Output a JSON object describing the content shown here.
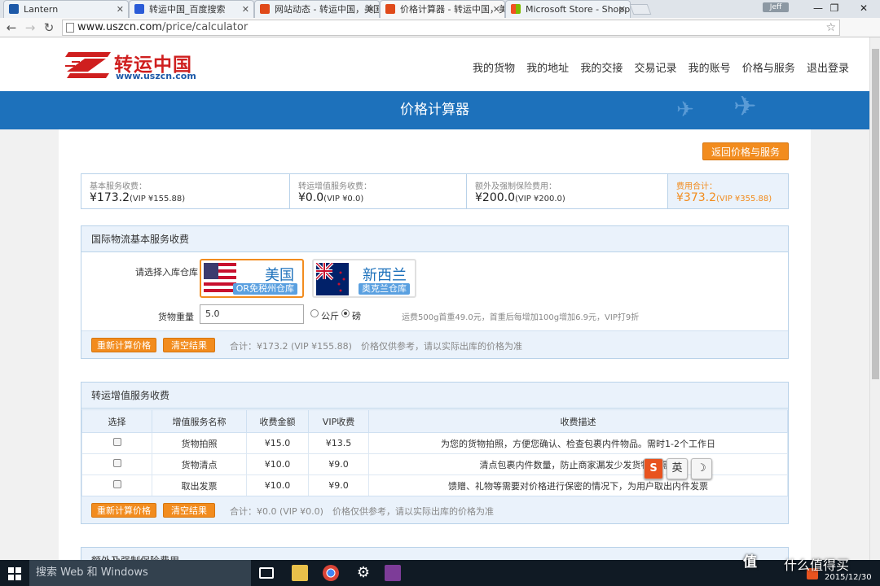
{
  "browser": {
    "tabs": [
      {
        "title": "Lantern",
        "icon_color": "#1d59a8"
      },
      {
        "title": "转运中国_百度搜索",
        "icon_color": "#2a5bd7"
      },
      {
        "title": "网站动态 - 转运中国，美国",
        "icon_color": "#e04a1a"
      },
      {
        "title": "价格计算器 - 转运中国，美",
        "icon_color": "#e04a1a"
      },
      {
        "title": "Microsoft Store - Shopp",
        "icon_color": "#f25022"
      }
    ],
    "active_tab": 3,
    "user": "Jeff",
    "url_host": "www.uszcn.com",
    "url_path": "/price/calculator"
  },
  "site": {
    "logo_text": "转运中国",
    "logo_url": "www.uszcn.com",
    "nav": [
      "我的货物",
      "我的地址",
      "我的交接",
      "交易记录",
      "我的账号",
      "价格与服务",
      "退出登录"
    ],
    "banner_title": "价格计算器",
    "return_button": "返回价格与服务"
  },
  "summary": [
    {
      "label": "基本服务收费：",
      "value": "¥173.2",
      "vip": "(VIP ¥155.88)"
    },
    {
      "label": "转运增值服务收费：",
      "value": "¥0.0",
      "vip": "(VIP ¥0.0)"
    },
    {
      "label": "额外及强制保险费用：",
      "value": "¥200.0",
      "vip": "(VIP ¥200.0)"
    },
    {
      "label": "费用合计：",
      "value": "¥373.2",
      "vip": "(VIP ¥355.88)"
    }
  ],
  "basic": {
    "title": "国际物流基本服务收费",
    "warehouse_label": "请选择入库仓库",
    "warehouses": [
      {
        "name": "美国",
        "sub": "OR免税州仓库"
      },
      {
        "name": "新西兰",
        "sub": "奥克兰仓库"
      }
    ],
    "weight_label": "货物重量",
    "weight_value": "5.0",
    "unit_kg": "公斤",
    "unit_lb": "磅",
    "rate_note": "运费500g首重49.0元，首重后每增加100g增加6.9元，VIP打9折",
    "recalc_button": "重新计算价格",
    "clear_button": "清空结果",
    "total_note": "合计：¥173.2 (VIP ¥155.88)　价格仅供参考，请以实际出库的价格为准"
  },
  "addon": {
    "title": "转运增值服务收费",
    "headers": [
      "选择",
      "增值服务名称",
      "收费金额",
      "VIP收费",
      "收费描述"
    ],
    "rows": [
      [
        "货物拍照",
        "¥15.0",
        "¥13.5",
        "为您的货物拍照，方便您确认、检查包裹内件物品。需时1-2个工作日"
      ],
      [
        "货物清点",
        "¥10.0",
        "¥9.0",
        "清点包裹内件数量，防止商家漏发少发货物。需时"
      ],
      [
        "取出发票",
        "¥10.0",
        "¥9.0",
        "馈赠、礼物等需要对价格进行保密的情况下，为用户取出内件发票"
      ]
    ],
    "recalc_button": "重新计算价格",
    "clear_button": "清空结果",
    "total_note": "合计：¥0.0 (VIP ¥0.0)　价格仅供参考，请以实际出库的价格为准"
  },
  "next_section_title": "额外及强制保险费用",
  "ime": {
    "s": "S",
    "lang": "英",
    "moon": "☽"
  },
  "taskbar": {
    "search_placeholder": "搜索 Web 和 Windows",
    "time": "",
    "date": "2015/12/30",
    "watermark_a": "值",
    "watermark_b": "什么值得买"
  },
  "colors": {
    "accent": "#f28c1e",
    "banner": "#1d71bb",
    "panel_border": "#b9d2e9"
  }
}
